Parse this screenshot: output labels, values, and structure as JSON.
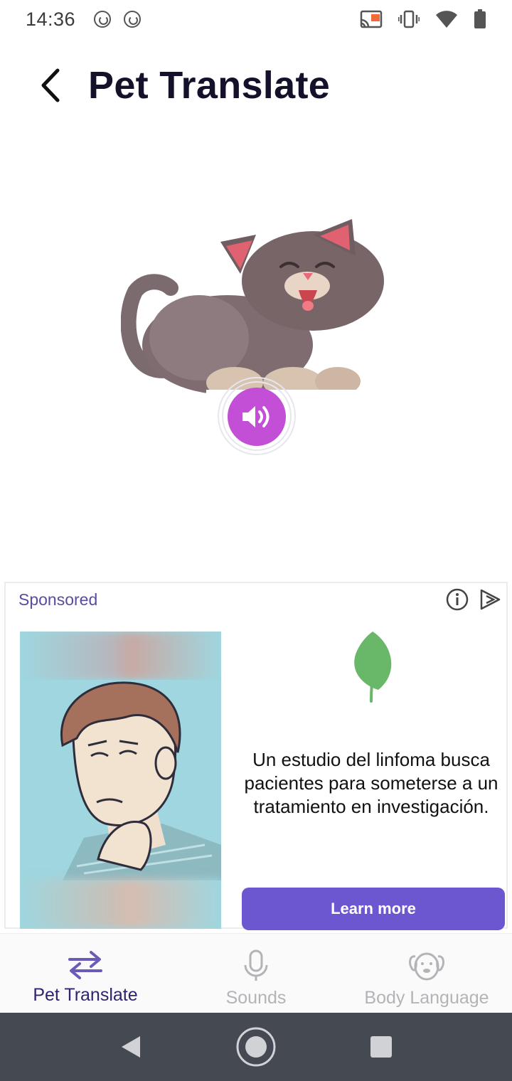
{
  "status_bar": {
    "time": "14:36",
    "left_icons": [
      "sync-icon",
      "sync-icon"
    ],
    "right_icons": [
      "cast-icon",
      "vibrate-icon",
      "wifi-icon",
      "battery-icon"
    ]
  },
  "app_bar": {
    "title": "Pet Translate",
    "back_icon": "back-arrow-icon"
  },
  "hero": {
    "image": "cat-illustration",
    "play_icon": "speaker-icon",
    "accent_color": "#c24fd6"
  },
  "ad": {
    "sponsored_label": "Sponsored",
    "info_icon": "info-icon",
    "adchoices_icon": "adchoices-icon",
    "image": "man-holding-neck-illustration",
    "logo": "leaf-icon",
    "headline": "Un estudio del linfoma busca pacientes para someterse a un tratamiento en investigación.",
    "cta_label": "Learn more",
    "cta_color": "#6c57d1"
  },
  "bottom_nav": {
    "items": [
      {
        "label": "Pet Translate",
        "icon": "swap-arrows-icon",
        "active": true
      },
      {
        "label": "Sounds",
        "icon": "microphone-icon",
        "active": false
      },
      {
        "label": "Body Language",
        "icon": "dog-face-icon",
        "active": false
      }
    ]
  },
  "system_nav": {
    "buttons": [
      "back-triangle-icon",
      "home-circle-icon",
      "recents-square-icon"
    ]
  }
}
